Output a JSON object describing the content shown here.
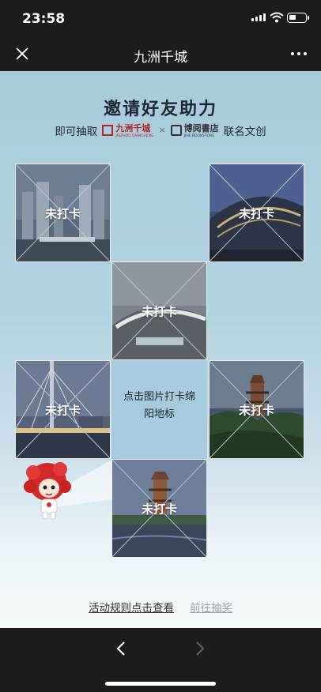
{
  "status": {
    "time": "23:58"
  },
  "nav": {
    "title": "九洲千城"
  },
  "header": {
    "headline": "邀请好友助力",
    "sub_prefix": "即可抽取",
    "brand1_cn": "九洲千城",
    "brand1_en": "JIUZHOU QIANCHENG",
    "cross": "×",
    "brand2_cn": "博阅書店",
    "brand2_en": "JIHE BOOKSTORE",
    "sub_suffix": "联名文创"
  },
  "tiles": [
    {
      "label": "未打卡",
      "scene": "towers"
    },
    {
      "label": "未打卡",
      "scene": "stadium"
    },
    {
      "label": "未打卡",
      "scene": "plaza"
    },
    {
      "label": "未打卡",
      "scene": "bridge"
    },
    {
      "label": "未打卡",
      "scene": "pagoda"
    },
    {
      "label": "未打卡",
      "scene": "tower-lake"
    }
  ],
  "center_text": "点击图片打卡绵阳地标",
  "links": {
    "rules": "活动规则点击查看",
    "draw": "前往抽奖"
  },
  "colors": {
    "bar": "#1c1c1c",
    "accent_red": "#b32424"
  }
}
